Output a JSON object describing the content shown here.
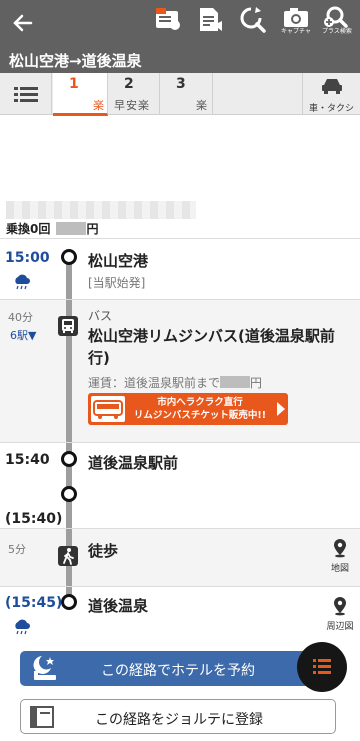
{
  "toolbar": {
    "back_icon": "arrow-left-icon",
    "tools": [
      {
        "name": "transit-card-icon",
        "caption": ""
      },
      {
        "name": "memo-share-icon",
        "caption": ""
      },
      {
        "name": "search-refresh-icon",
        "caption": ""
      },
      {
        "name": "camera-icon",
        "caption": "キャプチャ"
      },
      {
        "name": "plus-search-icon",
        "caption": "プラス検索"
      }
    ]
  },
  "route_title": "松山空港→道後温泉",
  "tabs": [
    {
      "num": "1",
      "tags": [
        "楽"
      ],
      "active": true
    },
    {
      "num": "2",
      "tags": [
        "早",
        "安",
        "楽"
      ],
      "active": false
    },
    {
      "num": "3",
      "tags": [
        "楽"
      ],
      "active": false
    }
  ],
  "car_taxi_label": "車・タクシ",
  "summary": {
    "prefix": "乗換0回",
    "suffix": "円"
  },
  "steps": {
    "dep_time": "15:00",
    "dep_station": "松山空港",
    "dep_note": "[当駅始発]",
    "bus_duration": "40分",
    "bus_stops": "6駅▼",
    "bus_type": "バス",
    "bus_line": "松山空港リムジンバス(道後温泉駅前行)",
    "fare_prefix": "運賃：道後温泉駅前まで",
    "fare_suffix": "円",
    "banner_line1": "市内へラクラク直行",
    "banner_line2": "リムジンバスチケット販売中!!",
    "arr_time": "15:40",
    "arr_station": "道後温泉駅前",
    "walk_start_time": "(15:40)",
    "walk_duration": "5分",
    "walk_label": "徒歩",
    "map_label": "地図",
    "dest_time": "(15:45)",
    "dest_station": "道後温泉",
    "area_map_label": "周辺図"
  },
  "buttons": {
    "hotel": "この経路でホテルを予約",
    "register": "この経路をジョルテに登録"
  },
  "colors": {
    "accent": "#e8581d",
    "blue": "#1e4d9b",
    "header": "#616161"
  }
}
